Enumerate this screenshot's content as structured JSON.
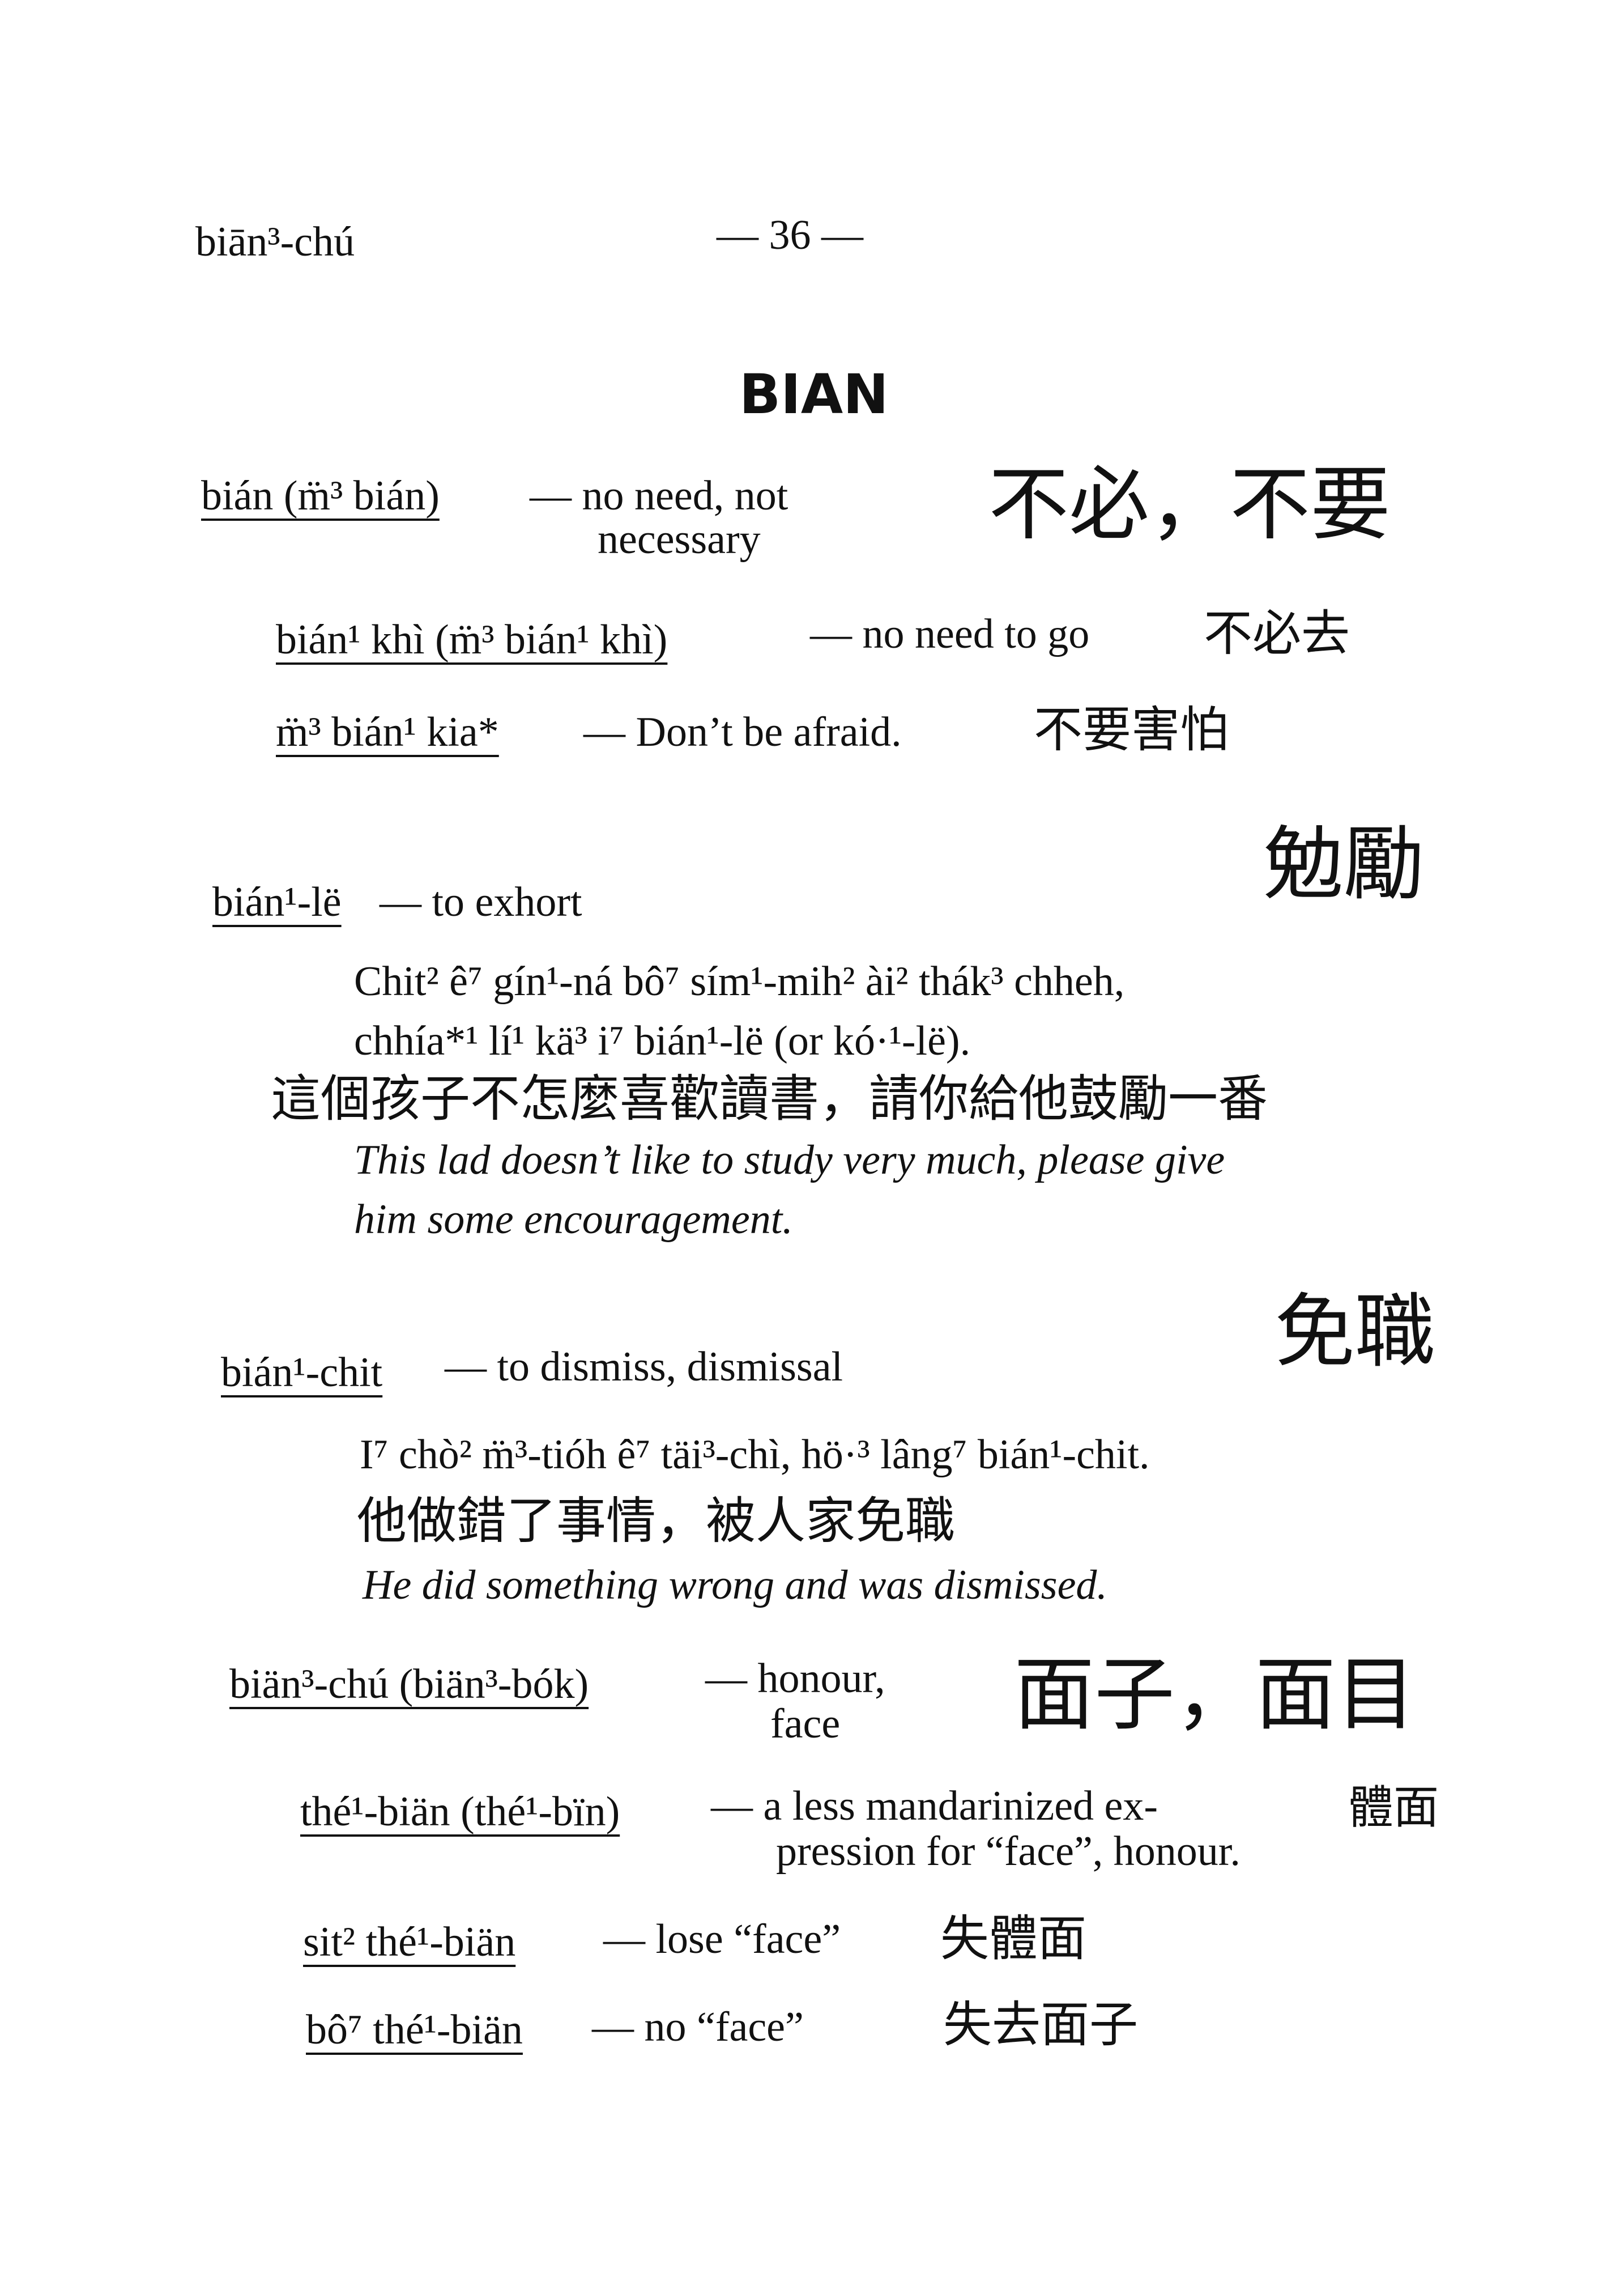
{
  "header": {
    "running_head": "biān³-chú",
    "page_number": "— 36 —"
  },
  "section_heading": "BIAN",
  "entries": [
    {
      "head": "bián (m̈³ bián)",
      "gloss_1": "— no need, not",
      "gloss_2": "necessary",
      "chinese": "不必，不要",
      "subentries": [
        {
          "head": "bián¹ khì (m̈³ bián¹ khì)",
          "gloss": "— no need to go",
          "chinese": "不必去"
        },
        {
          "head": "m̈³ bián¹ kia*",
          "gloss": "— Don’t be afraid.",
          "chinese": "不要害怕"
        }
      ]
    },
    {
      "head": "bián¹-lë",
      "gloss": "— to exhort",
      "chinese": "勉勵",
      "example": {
        "romanized_1": "Chit² ê⁷ gín¹-ná bô⁷ sím¹-mih² ài² thák³ chheh,",
        "romanized_2": "chhía*¹ lí¹ kä³ i⁷ bián¹-lë (or kó·¹-lë).",
        "chinese": "這個孩子不怎麼喜歡讀書，請你給他鼓勵一番",
        "english_1": "This lad doesn’t like to study very much, please give",
        "english_2": "him some encouragement."
      }
    },
    {
      "head": "bián¹-chit",
      "gloss": "— to dismiss, dismissal",
      "chinese": "免職",
      "example": {
        "romanized": "I⁷ chò² m̈³-tióh ê⁷ täi³-chì, hö·³ lâng⁷ bián¹-chit.",
        "chinese": "他做錯了事情，被人家免職",
        "english": "He did something wrong and was dismissed."
      }
    },
    {
      "head": "biän³-chú (biän³-bók)",
      "gloss_1": "— honour,",
      "gloss_2": "face",
      "chinese": "面子，面目",
      "subentries": [
        {
          "head": "thé¹-biän (thé¹-bïn)",
          "gloss_1": "— a less mandarinized ex-",
          "gloss_2": "pression for “face”, honour.",
          "chinese": "體面"
        },
        {
          "head": "sit² thé¹-biän",
          "gloss": "— lose “face”",
          "chinese": "失體面"
        },
        {
          "head": "bô⁷ thé¹-biän",
          "gloss": "— no “face”",
          "chinese": "失去面子"
        }
      ]
    }
  ]
}
